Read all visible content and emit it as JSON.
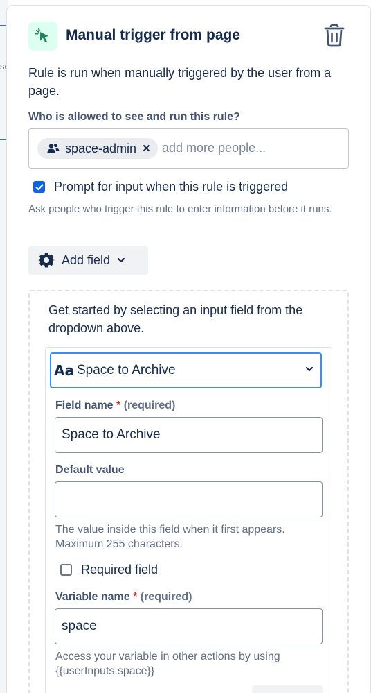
{
  "background": {
    "cut_text": "se"
  },
  "header": {
    "icon": "cursor-click-icon",
    "title": "Manual trigger from page",
    "delete_icon": "trash-icon"
  },
  "description": "Rule is run when manually triggered by the user from a page.",
  "permissions": {
    "label": "Who is allowed to see and run this rule?",
    "chips": [
      {
        "icon": "people-icon",
        "label": "space-admin",
        "remove_icon": "close-icon"
      }
    ],
    "placeholder": "add more people..."
  },
  "prompt": {
    "checked": true,
    "label": "Prompt for input when this rule is triggered",
    "helper": "Ask people who trigger this rule to enter information before it runs."
  },
  "add_field": {
    "label": "Add field",
    "icon": "gear-icon",
    "chevron": "chevron-down-icon"
  },
  "input_fields": {
    "intro": "Get started by selecting an input field from the dropdown above.",
    "field_type": {
      "icon_text": "Aa",
      "label": "Space to Archive"
    },
    "field_name": {
      "label": "Field name",
      "required_text": "(required)",
      "value": "Space to Archive"
    },
    "default_value": {
      "label": "Default value",
      "value": "",
      "helper": "The value inside this field when it first appears. Maximum 255 characters."
    },
    "required_field": {
      "checked": false,
      "label": "Required field"
    },
    "variable_name": {
      "label": "Variable name",
      "required_text": "(required)",
      "value": "space",
      "helper": "Access your variable in other actions by using {{userInputs.space}}"
    }
  },
  "colors": {
    "accent": "#0c66e4",
    "focus": "#388bff",
    "icon_bg": "#dcfff1",
    "icon_fg": "#1f845a",
    "required": "#c9372c"
  }
}
